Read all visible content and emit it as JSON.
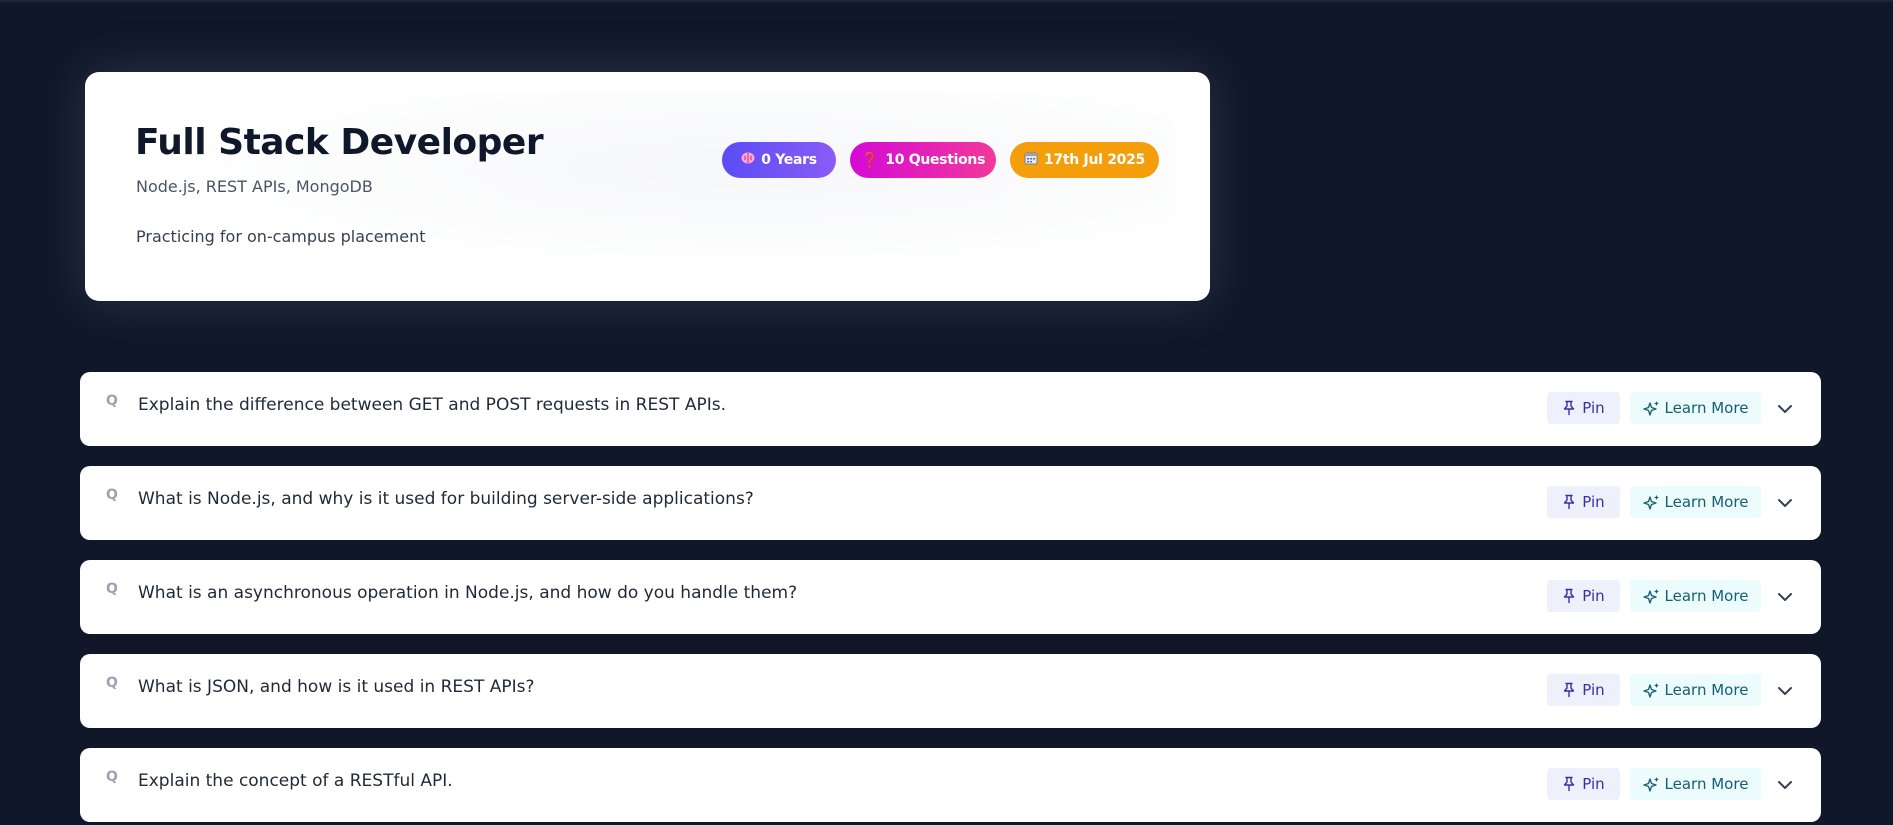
{
  "session": {
    "role": "Full Stack Developer",
    "topics": "Node.js, REST APIs, MongoDB",
    "description": "Practicing for on-campus placement",
    "badges": {
      "experience": "0 Years",
      "questions": "10 Questions",
      "date": "17th Jul 2025"
    },
    "badge_icons": {
      "experience": "brain-icon",
      "questions": "question-mark-icon",
      "date": "calendar-icon"
    }
  },
  "questions": [
    {
      "marker": "Q",
      "text": "Explain the difference between GET and POST requests in REST APIs.",
      "pin_label": "Pin",
      "learn_label": "Learn More"
    },
    {
      "marker": "Q",
      "text": "What is Node.js, and why is it used for building server-side applications?",
      "pin_label": "Pin",
      "learn_label": "Learn More"
    },
    {
      "marker": "Q",
      "text": "What is an asynchronous operation in Node.js, and how do you handle them?",
      "pin_label": "Pin",
      "learn_label": "Learn More"
    },
    {
      "marker": "Q",
      "text": "What is JSON, and how is it used in REST APIs?",
      "pin_label": "Pin",
      "learn_label": "Learn More"
    },
    {
      "marker": "Q",
      "text": "Explain the concept of a RESTful API.",
      "pin_label": "Pin",
      "learn_label": "Learn More"
    }
  ],
  "colors": {
    "background": "#0f1729",
    "card": "#ffffff",
    "badge_experience": "#6d4cf6",
    "badge_questions": "#e11fc0",
    "badge_date": "#f59e0b",
    "pin_bg": "#eef0fb",
    "learn_bg": "#ecfbfb"
  }
}
